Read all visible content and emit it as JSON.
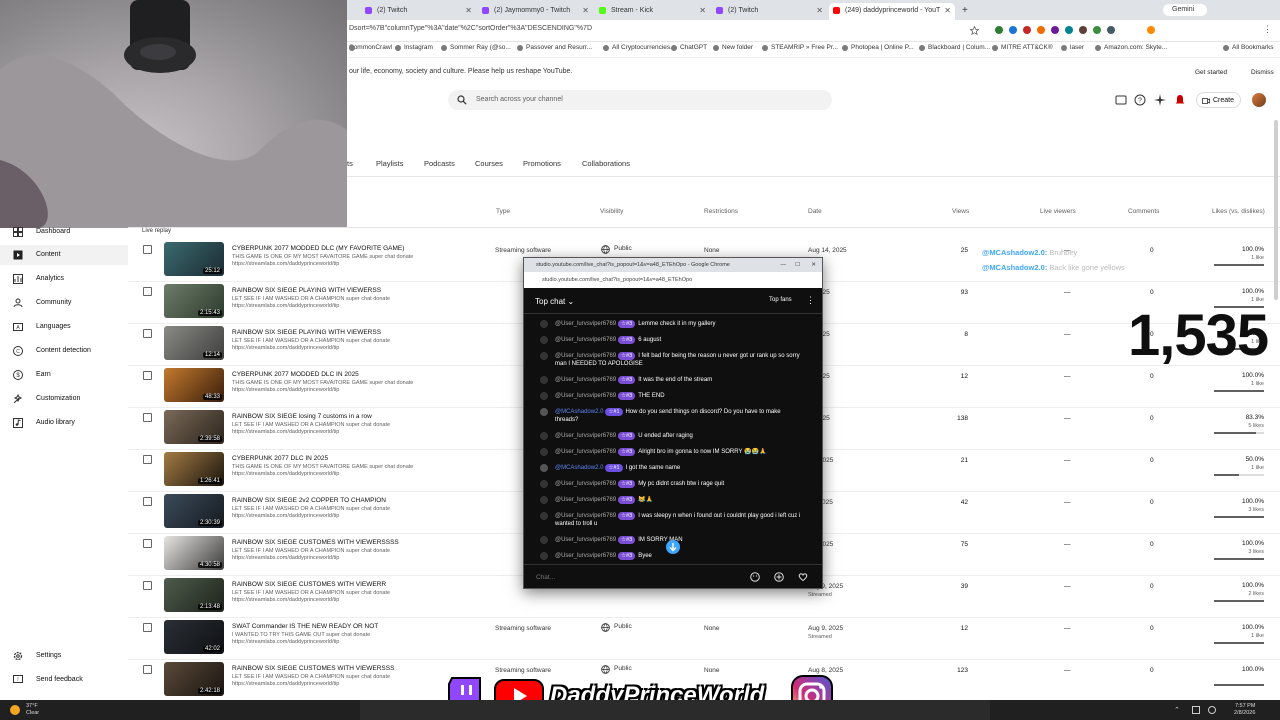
{
  "browser": {
    "tabs": [
      {
        "label": "(2) Twitch",
        "icon": "twitch",
        "active": false
      },
      {
        "label": "(2) Jaymommy0 - Twitch",
        "icon": "twitch",
        "active": false
      },
      {
        "label": "Stream - Kick",
        "icon": "kick",
        "active": false
      },
      {
        "label": "(2) Twitch",
        "icon": "twitch",
        "active": false
      },
      {
        "label": "(249) daddyprinceworld - YouT",
        "icon": "youtube",
        "active": true
      }
    ],
    "gemini_label": "Gemini",
    "url": "Dsort=%7B\"columnType\"%3A\"date\"%2C\"sortOrder\"%3A\"DESCENDING\"%7D",
    "bookmarks": [
      "CommonCrawl",
      "Instagram",
      "Sommer Ray (@so...",
      "Passover and Resurr...",
      "All Cryptocurrencies...",
      "ChatGPT",
      "New folder",
      "STEAMRIP » Free Pr...",
      "Photopea | Online P...",
      "Blackboard | Colum...",
      "MITRE ATT&CK®",
      "laser",
      "Amazon.com: Skyte..."
    ],
    "all_bookmarks": "All Bookmarks"
  },
  "studio": {
    "banner_text": "our life, economy, society and culture. Please help us reshape YouTube.",
    "get_started": "Get started",
    "dismiss": "Dismiss",
    "search_placeholder": "Search across your channel",
    "create_label": "Create",
    "content_tabs": [
      "ts",
      "Playlists",
      "Podcasts",
      "Courses",
      "Promotions",
      "Collaborations"
    ],
    "columns": {
      "type": "Type",
      "visibility": "Visibility",
      "restrictions": "Restrictions",
      "date": "Date",
      "views": "Views",
      "live_viewers": "Live viewers",
      "comments": "Comments",
      "likes": "Likes (vs. dislikes)"
    },
    "live_replay": "Live replay"
  },
  "sidebar": {
    "items": [
      {
        "label": "Dashboard",
        "icon": "dashboard-icon"
      },
      {
        "label": "Content",
        "icon": "content-icon",
        "selected": true
      },
      {
        "label": "Analytics",
        "icon": "analytics-icon"
      },
      {
        "label": "Community",
        "icon": "community-icon"
      },
      {
        "label": "Languages",
        "icon": "languages-icon"
      },
      {
        "label": "Content detection",
        "icon": "copyright-icon"
      },
      {
        "label": "Earn",
        "icon": "earn-icon"
      },
      {
        "label": "Customization",
        "icon": "customization-icon"
      },
      {
        "label": "Audio library",
        "icon": "audio-library-icon"
      }
    ],
    "settings": "Settings",
    "feedback": "Send feedback"
  },
  "videos": [
    {
      "title": "CYBERPUNK 2077 MODDED DLC (MY FAVORITE GAME)",
      "desc1": "THIS GAME IS ONE OF MY MOST FAVAITORE GAME super chat donate",
      "desc2": "https://streamlabs.com/daddyprinceworld/tip",
      "duration": "25:12",
      "type": "Streaming software",
      "visibility": "Public",
      "restrictions": "None",
      "date": "Aug 14, 2025",
      "status": "",
      "views": "25",
      "live": "—",
      "comments": "0",
      "likes": "100.0%",
      "likes_count": "1 like",
      "like_ratio": 1.0,
      "thumb": [
        "#3a6b6e",
        "#1c2a33"
      ]
    },
    {
      "title": "RAINBOW SIX SIEGE PLAYING WITH VIEWERSS",
      "desc1": "LET SEE IF I AM WASHED OR A CHAMPION super chat donate",
      "desc2": "https://streamlabs.com/daddyprinceworld/tip",
      "duration": "2:15:43",
      "type": "",
      "visibility": "",
      "restrictions": "",
      "date": "3, 2025",
      "status": "",
      "views": "93",
      "live": "—",
      "comments": "0",
      "likes": "100.0%",
      "likes_count": "1 like",
      "like_ratio": 1.0,
      "thumb": [
        "#6d7d6a",
        "#2c3a2c"
      ]
    },
    {
      "title": "RAINBOW SIX SIEGE PLAYING WITH VIEWERSS",
      "desc1": "LET SEE IF I AM WASHED OR A CHAMPION super chat donate",
      "desc2": "https://streamlabs.com/daddyprinceworld/tip",
      "duration": "12:14",
      "type": "",
      "visibility": "",
      "restrictions": "",
      "date": "2, 2025",
      "status": "",
      "views": "8",
      "live": "—",
      "comments": "0",
      "likes": "100.0%",
      "likes_count": "1 like",
      "like_ratio": 1.0,
      "thumb": [
        "#8a8a86",
        "#3d3e3c"
      ]
    },
    {
      "title": "CYBERPUNK 2077 MODDED DLC IN 2025",
      "desc1": "THIS GAME IS ONE OF MY MOST FAVAITORE GAME super chat donate",
      "desc2": "https://streamlabs.com/daddyprinceworld/tip",
      "duration": "48:33",
      "type": "",
      "visibility": "",
      "restrictions": "",
      "date": "2, 2025",
      "status": "",
      "views": "12",
      "live": "—",
      "comments": "0",
      "likes": "100.0%",
      "likes_count": "1 like",
      "like_ratio": 1.0,
      "thumb": [
        "#c47a2e",
        "#3a1d0c"
      ]
    },
    {
      "title": "RAINBOW SIX SIEGE losing 7 customs in a row",
      "desc1": "LET SEE IF I AM WASHED OR A CHAMPION super chat donate",
      "desc2": "https://streamlabs.com/daddyprinceworld/tip",
      "duration": "2:39:58",
      "type": "",
      "visibility": "",
      "restrictions": "",
      "date": "1, 2025",
      "status": "",
      "views": "138",
      "live": "—",
      "comments": "0",
      "likes": "83.3%",
      "likes_count": "5 likes",
      "like_ratio": 0.833,
      "thumb": [
        "#7a6a58",
        "#2c241d"
      ]
    },
    {
      "title": "CYBERPUNK 2077 DLC IN 2025",
      "desc1": "THIS GAME IS ONE OF MY MOST FAVAITORE GAME super chat donate",
      "desc2": "https://streamlabs.com/daddyprinceworld/tip",
      "duration": "1:26:41",
      "type": "",
      "visibility": "",
      "restrictions": "",
      "date": "12, 2025",
      "status": "",
      "views": "21",
      "live": "—",
      "comments": "0",
      "likes": "50.0%",
      "likes_count": "1 like",
      "like_ratio": 0.5,
      "thumb": [
        "#a47c45",
        "#1a140c"
      ]
    },
    {
      "title": "RAINBOW SIX SIEGE 2v2 COPPER TO CHAMPION",
      "desc1": "LET SEE IF I AM WASHED OR A CHAMPION super chat donate",
      "desc2": "https://streamlabs.com/daddyprinceworld/tip",
      "duration": "2:30:39",
      "type": "",
      "visibility": "",
      "restrictions": "",
      "date": "11, 2025",
      "status": "",
      "views": "42",
      "live": "—",
      "comments": "0",
      "likes": "100.0%",
      "likes_count": "3 likes",
      "like_ratio": 1.0,
      "thumb": [
        "#3c4b5a",
        "#141a20"
      ]
    },
    {
      "title": "RAINBOW SIX SIEGE CUSTOMES WITH VIEWERSSSS",
      "desc1": "LET SEE IF I AM WASHED OR A CHAMPION super chat donate",
      "desc2": "https://streamlabs.com/daddyprinceworld/tip",
      "duration": "4:30:58",
      "type": "",
      "visibility": "",
      "restrictions": "",
      "date": "10, 2025",
      "status": "",
      "views": "75",
      "live": "—",
      "comments": "0",
      "likes": "100.0%",
      "likes_count": "3 likes",
      "like_ratio": 1.0,
      "thumb": [
        "#e8e6e3",
        "#3b3b3b"
      ]
    },
    {
      "title": "RAINBOW SIX SIEGE CUSTOMES WITH VIEWERR",
      "desc1": "LET SEE IF I AM WASHED OR A CHAMPION super chat donate",
      "desc2": "https://streamlabs.com/daddyprinceworld/tip",
      "duration": "2:13:48",
      "type": "",
      "visibility": "",
      "restrictions": "",
      "date": "Aug 9, 2025",
      "status": "Streamed",
      "views": "39",
      "live": "—",
      "comments": "0",
      "likes": "100.0%",
      "likes_count": "2 likes",
      "like_ratio": 1.0,
      "thumb": [
        "#4f5b4c",
        "#1d231b"
      ]
    },
    {
      "title": "SWAT Commander IS THE NEW READY OR NOT",
      "desc1": "I WANTED TO TRY THIS GAME OUT super chat donate",
      "desc2": "https://streamlabs.com/daddyprinceworld/tip",
      "duration": "42:02",
      "type": "Streaming software",
      "visibility": "Public",
      "restrictions": "None",
      "date": "Aug 9, 2025",
      "status": "Streamed",
      "views": "12",
      "live": "—",
      "comments": "0",
      "likes": "100.0%",
      "likes_count": "1 like",
      "like_ratio": 1.0,
      "thumb": [
        "#2b2f36",
        "#0e1013"
      ]
    },
    {
      "title": "RAINBOW SIX SIEGE CUSTOMES WITH VIEWERSSS",
      "desc1": "LET SEE IF I AM WASHED OR A CHAMPION super chat donate",
      "desc2": "https://streamlabs.com/daddyprinceworld/tip",
      "duration": "2:42:18",
      "type": "Streaming software",
      "visibility": "Public",
      "restrictions": "None",
      "date": "Aug 8, 2025",
      "status": "",
      "views": "123",
      "live": "—",
      "comments": "0",
      "likes": "100.0%",
      "likes_count": "",
      "like_ratio": 1.0,
      "thumb": [
        "#5a4a3a",
        "#1a140f"
      ]
    }
  ],
  "chat": {
    "window_title": "studio.youtube.com/live_chat?is_popout=1&v=a48_ETEhOpo - Google Chrome",
    "url": "studio.youtube.com/live_chat?is_popout=1&v=a48_ETEhOpo",
    "header": "Top chat",
    "top_fans": "Top fans",
    "input_placeholder": "Chat...",
    "messages": [
      {
        "user": "@User_lurvsviper6769",
        "badge": "#3",
        "text": "Lemme check it in my gallery",
        "mod": false
      },
      {
        "user": "@User_lurvsviper6769",
        "badge": "#3",
        "text": "6 august",
        "mod": false
      },
      {
        "user": "@User_lurvsviper6769",
        "badge": "#3",
        "text": "I felt bad for being the reason u never got ur rank up so sorry man I NEEDED TO APOLOGISE",
        "mod": false
      },
      {
        "user": "@User_lurvsviper6769",
        "badge": "#3",
        "text": "It was the end of the stream",
        "mod": false
      },
      {
        "user": "@User_lurvsviper6769",
        "badge": "#3",
        "text": "THE END",
        "mod": false
      },
      {
        "user": "@MCAshadow2.0",
        "badge": "#1",
        "text": "How do you send things on discord? Do you have to make threads?",
        "mod": true
      },
      {
        "user": "@User_lurvsviper6769",
        "badge": "#3",
        "text": "U ended after raging",
        "mod": false
      },
      {
        "user": "@User_lurvsviper6769",
        "badge": "#3",
        "text": "Alright bro im gonna to now IM SORRY 😭😭🙏",
        "mod": false
      },
      {
        "user": "@MCAshadow2.0",
        "badge": "#1",
        "text": "I got the same name",
        "mod": true
      },
      {
        "user": "@User_lurvsviper6769",
        "badge": "#3",
        "text": "My pc didnt crash btw i rage quit",
        "mod": false
      },
      {
        "user": "@User_lurvsviper6769",
        "badge": "#3",
        "text": "😹🙏",
        "mod": false
      },
      {
        "user": "@User_lurvsviper6769",
        "badge": "#3",
        "text": "I was sleepy n when i found out i couldnt play good i left cuz i wanted to troll u",
        "mod": false
      },
      {
        "user": "@User_lurvsviper6769",
        "badge": "#3",
        "text": "IM SORRY MAN",
        "mod": false
      },
      {
        "user": "@User_lurvsviper6769",
        "badge": "#3",
        "text": "Byee",
        "mod": false
      }
    ]
  },
  "overlay": {
    "messages": [
      {
        "user": "@MCAshadow2.0:",
        "text": "Bruhbey"
      },
      {
        "user": "@MCAshadow2.0:",
        "text": "Back like gone yellows"
      }
    ],
    "count": "1,535"
  },
  "stream_banner": {
    "name": "DaddyPrinceWorld"
  },
  "taskbar": {
    "weather_temp": "37°F",
    "weather_desc": "Clear",
    "time": "7:57 PM",
    "date": "2/8/2026"
  }
}
